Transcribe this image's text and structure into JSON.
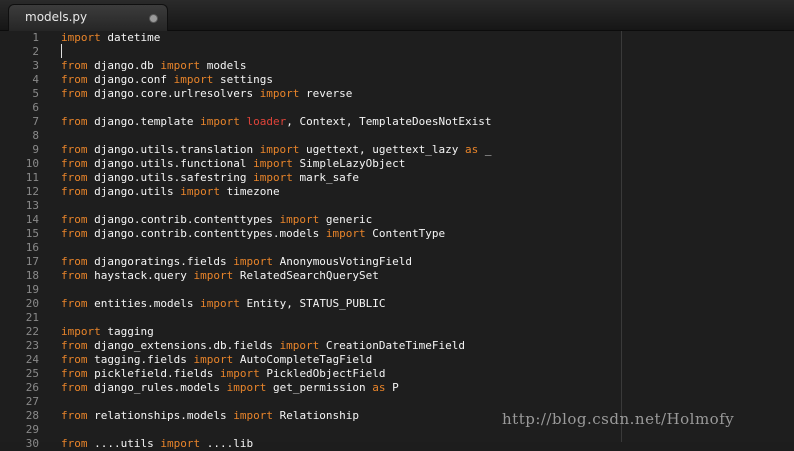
{
  "tab": {
    "title": "models.py"
  },
  "watermark": "http://blog.csdn.net/Holmofy",
  "colors": {
    "background": "#1e1e1e",
    "keyword": "#e8842a",
    "text": "#f5f5f5",
    "highlight": "#e0443a",
    "line_number": "#8a8a8a"
  },
  "lines": [
    {
      "n": "1",
      "t": [
        [
          "k",
          "import"
        ],
        [
          "",
          " datetime"
        ]
      ]
    },
    {
      "n": "2",
      "t": []
    },
    {
      "n": "3",
      "t": [
        [
          "k",
          "from"
        ],
        [
          "",
          " django.db "
        ],
        [
          "k",
          "import"
        ],
        [
          "",
          " models"
        ]
      ]
    },
    {
      "n": "4",
      "t": [
        [
          "k",
          "from"
        ],
        [
          "",
          " django.conf "
        ],
        [
          "k",
          "import"
        ],
        [
          "",
          " settings"
        ]
      ]
    },
    {
      "n": "5",
      "t": [
        [
          "k",
          "from"
        ],
        [
          "",
          " django.core.urlresolvers "
        ],
        [
          "k",
          "import"
        ],
        [
          "",
          " reverse"
        ]
      ]
    },
    {
      "n": "6",
      "t": []
    },
    {
      "n": "7",
      "t": [
        [
          "k",
          "from"
        ],
        [
          "",
          " django.template "
        ],
        [
          "k",
          "import"
        ],
        [
          "",
          " "
        ],
        [
          "h",
          "loader"
        ],
        [
          "",
          ", Context, TemplateDoesNotExist"
        ]
      ]
    },
    {
      "n": "8",
      "t": []
    },
    {
      "n": "9",
      "t": [
        [
          "k",
          "from"
        ],
        [
          "",
          " django.utils.translation "
        ],
        [
          "k",
          "import"
        ],
        [
          "",
          " ugettext, ugettext_lazy "
        ],
        [
          "k",
          "as"
        ],
        [
          "",
          " _"
        ]
      ]
    },
    {
      "n": "10",
      "t": [
        [
          "k",
          "from"
        ],
        [
          "",
          " django.utils.functional "
        ],
        [
          "k",
          "import"
        ],
        [
          "",
          " SimpleLazyObject"
        ]
      ]
    },
    {
      "n": "11",
      "t": [
        [
          "k",
          "from"
        ],
        [
          "",
          " django.utils.safestring "
        ],
        [
          "k",
          "import"
        ],
        [
          "",
          " mark_safe"
        ]
      ]
    },
    {
      "n": "12",
      "t": [
        [
          "k",
          "from"
        ],
        [
          "",
          " django.utils "
        ],
        [
          "k",
          "import"
        ],
        [
          "",
          " timezone"
        ]
      ]
    },
    {
      "n": "13",
      "t": []
    },
    {
      "n": "14",
      "t": [
        [
          "k",
          "from"
        ],
        [
          "",
          " django.contrib.contenttypes "
        ],
        [
          "k",
          "import"
        ],
        [
          "",
          " generic"
        ]
      ]
    },
    {
      "n": "15",
      "t": [
        [
          "k",
          "from"
        ],
        [
          "",
          " django.contrib.contenttypes.models "
        ],
        [
          "k",
          "import"
        ],
        [
          "",
          " ContentType"
        ]
      ]
    },
    {
      "n": "16",
      "t": []
    },
    {
      "n": "17",
      "t": [
        [
          "k",
          "from"
        ],
        [
          "",
          " djangoratings.fields "
        ],
        [
          "k",
          "import"
        ],
        [
          "",
          " AnonymousVotingField"
        ]
      ]
    },
    {
      "n": "18",
      "t": [
        [
          "k",
          "from"
        ],
        [
          "",
          " haystack.query "
        ],
        [
          "k",
          "import"
        ],
        [
          "",
          " RelatedSearchQuerySet"
        ]
      ]
    },
    {
      "n": "19",
      "t": []
    },
    {
      "n": "20",
      "t": [
        [
          "k",
          "from"
        ],
        [
          "",
          " entities.models "
        ],
        [
          "k",
          "import"
        ],
        [
          "",
          " Entity, STATUS_PUBLIC"
        ]
      ]
    },
    {
      "n": "21",
      "t": []
    },
    {
      "n": "22",
      "t": [
        [
          "k",
          "import"
        ],
        [
          "",
          " tagging"
        ]
      ]
    },
    {
      "n": "23",
      "t": [
        [
          "k",
          "from"
        ],
        [
          "",
          " django_extensions.db.fields "
        ],
        [
          "k",
          "import"
        ],
        [
          "",
          " CreationDateTimeField"
        ]
      ]
    },
    {
      "n": "24",
      "t": [
        [
          "k",
          "from"
        ],
        [
          "",
          " tagging.fields "
        ],
        [
          "k",
          "import"
        ],
        [
          "",
          " AutoCompleteTagField"
        ]
      ]
    },
    {
      "n": "25",
      "t": [
        [
          "k",
          "from"
        ],
        [
          "",
          " picklefield.fields "
        ],
        [
          "k",
          "import"
        ],
        [
          "",
          " PickledObjectField"
        ]
      ]
    },
    {
      "n": "26",
      "t": [
        [
          "k",
          "from"
        ],
        [
          "",
          " django_rules.models "
        ],
        [
          "k",
          "import"
        ],
        [
          "",
          " get_permission "
        ],
        [
          "k",
          "as"
        ],
        [
          "",
          " P"
        ]
      ]
    },
    {
      "n": "27",
      "t": []
    },
    {
      "n": "28",
      "t": [
        [
          "k",
          "from"
        ],
        [
          "",
          " relationships.models "
        ],
        [
          "k",
          "import"
        ],
        [
          "",
          " Relationship"
        ]
      ]
    },
    {
      "n": "29",
      "t": []
    },
    {
      "n": "30",
      "t": [
        [
          "k",
          "from"
        ],
        [
          "",
          " ....utils "
        ],
        [
          "k",
          "import"
        ],
        [
          "",
          " ....lib"
        ]
      ]
    }
  ]
}
